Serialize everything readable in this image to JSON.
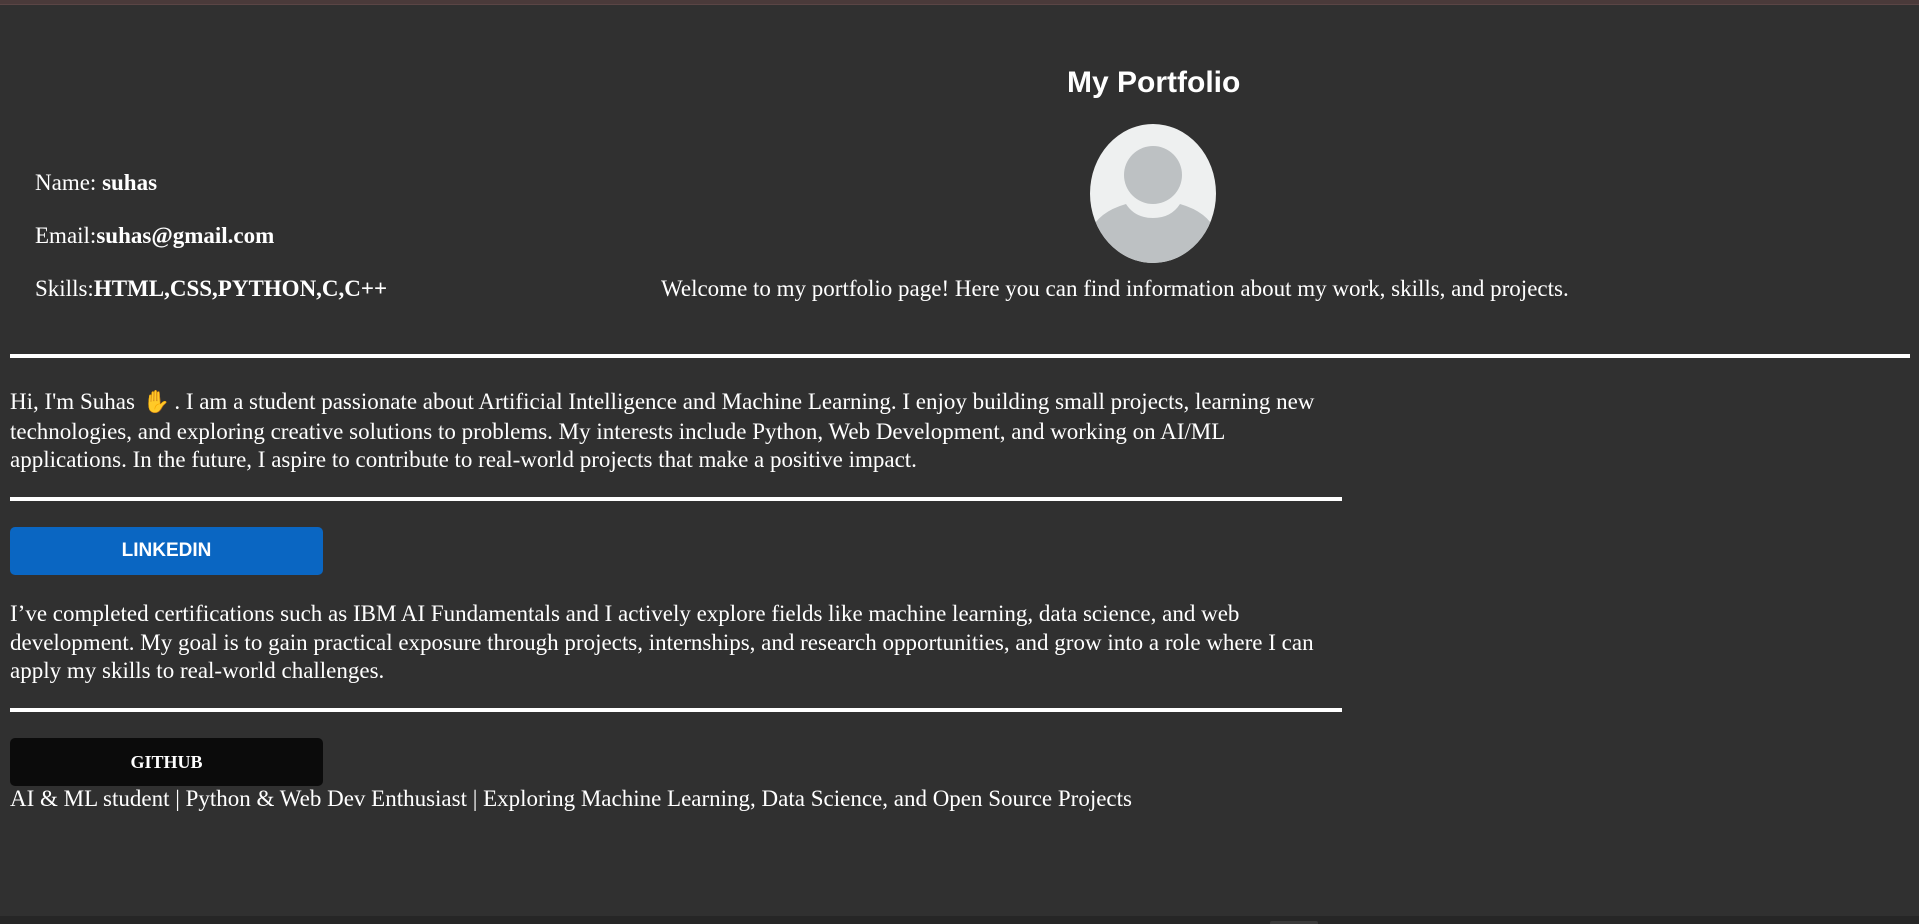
{
  "header": {
    "title": "My Portfolio",
    "welcome": "Welcome to my portfolio page! Here you can find information about my work, skills, and projects."
  },
  "profile": {
    "name_label": "Name: ",
    "name_value": "suhas",
    "email_label": "Email:",
    "email_value": "suhas@gmail.com",
    "skills_label": "Skills:",
    "skills_value": "HTML,CSS,PYTHON,C,C++",
    "avatar_icon": "user-placeholder-icon"
  },
  "about": {
    "intro": "Hi, I'm Suhas",
    "wave_icon": "waving-hand-icon",
    "wave_glyph": "✋",
    "body": ". I am a student passionate about Artificial Intelligence and Machine Learning. I enjoy building small projects, learning new technologies, and exploring creative solutions to problems. My interests include Python, Web Development, and working on AI/ML applications. In the future, I aspire to contribute to real-world projects that make a positive impact."
  },
  "linkedin": {
    "label": "LINKEDIN",
    "color": "#0a66c2",
    "text": "I’ve completed certifications such as IBM AI Fundamentals and I actively explore fields like machine learning, data science, and web development. My goal is to gain practical exposure through projects, internships, and research opportunities, and grow into a role where I can apply my skills to real-world challenges."
  },
  "github": {
    "label": "GITHUB",
    "color": "#0b0b0b",
    "text": "AI & ML student | Python & Web Dev Enthusiast | Exploring Machine Learning, Data Science, and Open Source Projects"
  },
  "colors": {
    "background": "#303030",
    "text": "#ffffff",
    "divider": "#ffffff"
  }
}
